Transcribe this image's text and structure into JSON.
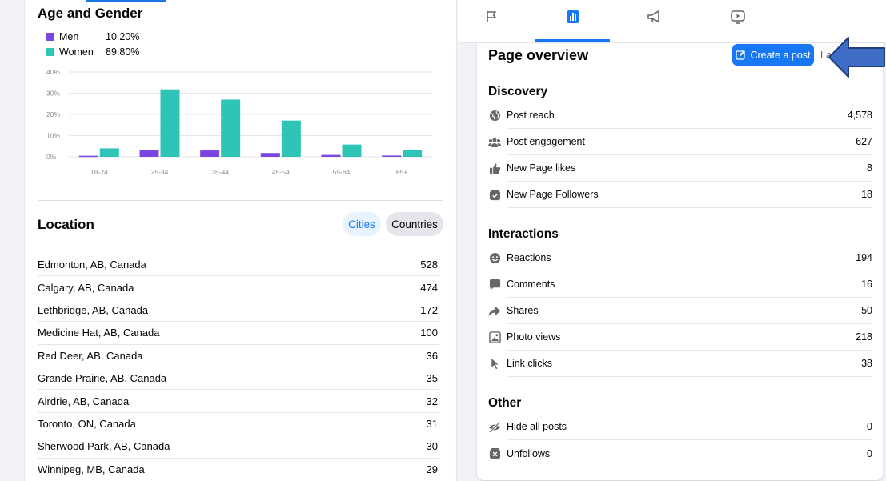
{
  "age_gender": {
    "title": "Age and Gender",
    "legend": [
      {
        "name": "Men",
        "value": "10.20%",
        "color": "#7b45e2"
      },
      {
        "name": "Women",
        "value": "89.80%",
        "color": "#2ec4b6"
      }
    ]
  },
  "chart_data": {
    "type": "bar",
    "categories": [
      "18-24",
      "25-34",
      "35-44",
      "45-54",
      "55-64",
      "65+"
    ],
    "series": [
      {
        "name": "Men",
        "values": [
          0.5,
          3.3,
          3.0,
          1.8,
          0.9,
          0.6
        ]
      },
      {
        "name": "Women",
        "values": [
          4.0,
          31.8,
          27.0,
          17.1,
          5.8,
          3.3
        ]
      }
    ],
    "ylim": [
      0,
      40
    ],
    "yticks": [
      "0%",
      "10%",
      "20%",
      "30%",
      "40%"
    ],
    "grid": true
  },
  "location": {
    "title": "Location",
    "cities_label": "Cities",
    "countries_label": "Countries",
    "rows": [
      {
        "name": "Edmonton, AB, Canada",
        "value": "528"
      },
      {
        "name": "Calgary, AB, Canada",
        "value": "474"
      },
      {
        "name": "Lethbridge, AB, Canada",
        "value": "172"
      },
      {
        "name": "Medicine Hat, AB, Canada",
        "value": "100"
      },
      {
        "name": "Red Deer, AB, Canada",
        "value": "36"
      },
      {
        "name": "Grande Prairie, AB, Canada",
        "value": "35"
      },
      {
        "name": "Airdrie, AB, Canada",
        "value": "32"
      },
      {
        "name": "Toronto, ON, Canada",
        "value": "31"
      },
      {
        "name": "Sherwood Park, AB, Canada",
        "value": "30"
      },
      {
        "name": "Winnipeg, MB, Canada",
        "value": "29"
      }
    ]
  },
  "tabs": [
    {
      "icon": "flag-icon"
    },
    {
      "icon": "insights-icon",
      "active": true
    },
    {
      "icon": "megaphone-icon"
    },
    {
      "icon": "video-play-icon"
    }
  ],
  "overview": {
    "title": "Page overview",
    "create_post_label": "Create a post",
    "cut_text": "La",
    "discovery": {
      "title": "Discovery",
      "items": [
        {
          "label": "Post reach",
          "value": "4,578",
          "icon": "globe-icon"
        },
        {
          "label": "Post engagement",
          "value": "627",
          "icon": "people-icon"
        },
        {
          "label": "New Page likes",
          "value": "8",
          "icon": "thumbs-up-icon"
        },
        {
          "label": "New Page Followers",
          "value": "18",
          "icon": "follow-check-icon"
        }
      ]
    },
    "interactions": {
      "title": "Interactions",
      "items": [
        {
          "label": "Reactions",
          "value": "194",
          "icon": "smiley-icon"
        },
        {
          "label": "Comments",
          "value": "16",
          "icon": "comment-icon"
        },
        {
          "label": "Shares",
          "value": "50",
          "icon": "share-arrow-icon"
        },
        {
          "label": "Photo views",
          "value": "218",
          "icon": "photo-icon"
        },
        {
          "label": "Link clicks",
          "value": "38",
          "icon": "cursor-icon"
        }
      ]
    },
    "other": {
      "title": "Other",
      "items": [
        {
          "label": "Hide all posts",
          "value": "0",
          "icon": "eye-off-icon"
        },
        {
          "label": "Unfollows",
          "value": "0",
          "icon": "unfollow-icon"
        }
      ]
    }
  }
}
